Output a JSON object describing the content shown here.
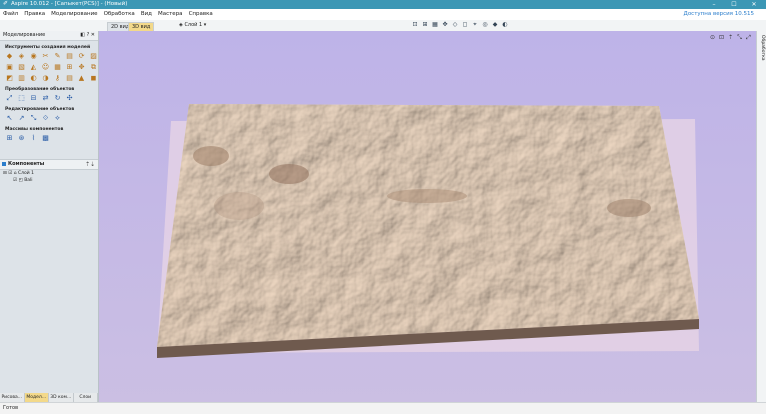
{
  "window": {
    "title": "Aspire 10.012 - [Сапыкет(PCS)] - (Новый)",
    "controls": [
      "–",
      "☐",
      "✕"
    ]
  },
  "menu": {
    "items": [
      "Файл",
      "Правка",
      "Моделирование",
      "Обработка",
      "Вид",
      "Мастера",
      "Справка"
    ],
    "version_link": "Доступна версия 10.515"
  },
  "tabs": {
    "view2d": "2D вид",
    "view3d": "3D вид",
    "layer": "Слой 1"
  },
  "panel": {
    "header": "Моделирование",
    "header_icons": "◧ ? ✕",
    "sections": {
      "create": "Инструменты создания моделей",
      "transform": "Преобразование объектов",
      "edit": "Редактирование объектов",
      "arrays": "Массивы компонентов"
    },
    "components_header": "Компоненты",
    "tree": {
      "layer": "Слой 1",
      "item": "Bali"
    },
    "bottom_tabs": [
      "Рисова...",
      "Модел...",
      "3D ком...",
      "Слои"
    ]
  },
  "right_panel": {
    "label": "Обработка"
  },
  "status": {
    "text": "Готов"
  },
  "colors": {
    "titlebar": "#3b97b5",
    "viewport_bg": "#c3b8e8",
    "relief": "#e8cdb5",
    "active_tab": "#f3d98a"
  }
}
